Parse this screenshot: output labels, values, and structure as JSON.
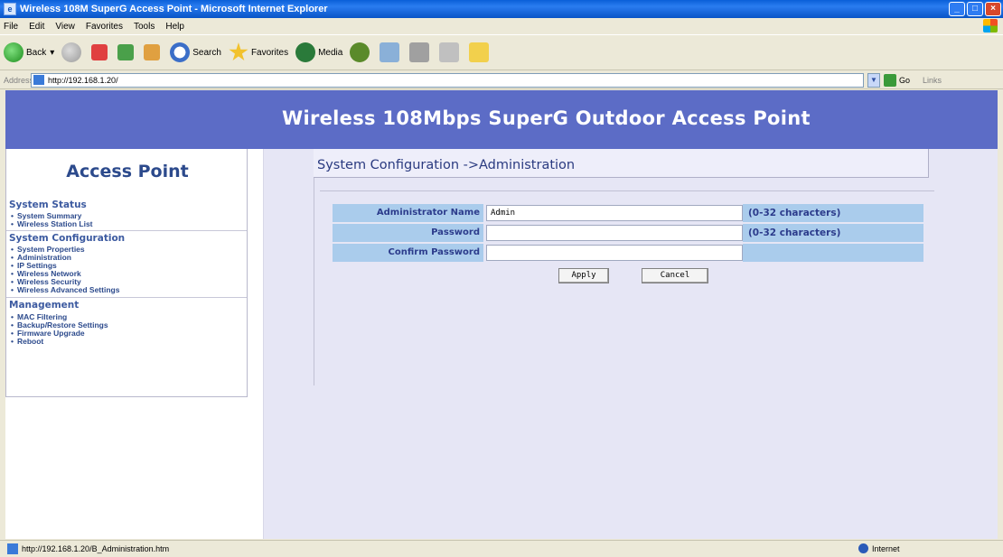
{
  "window": {
    "title": "Wireless 108M SuperG Access Point - Microsoft Internet Explorer"
  },
  "menu": [
    "File",
    "Edit",
    "View",
    "Favorites",
    "Tools",
    "Help"
  ],
  "toolbar": {
    "back_label": "Back",
    "search_label": "Search",
    "favorites_label": "Favorites",
    "media_label": "Media"
  },
  "address": {
    "label": "Address",
    "url": "http://192.168.1.20/",
    "go_label": "Go",
    "links_label": "Links"
  },
  "banner": {
    "title": "Wireless 108Mbps SuperG Outdoor Access Point"
  },
  "sidebar": {
    "title": "Access Point",
    "sections": [
      {
        "heading": "System Status",
        "items": [
          "System Summary",
          "Wireless Station List"
        ]
      },
      {
        "heading": "System Configuration",
        "items": [
          "System Properties",
          "Administration",
          "IP Settings",
          "Wireless Network",
          "Wireless Security",
          "Wireless Advanced Settings"
        ]
      },
      {
        "heading": "Management",
        "items": [
          "MAC Filtering",
          "Backup/Restore Settings",
          "Firmware Upgrade",
          "Reboot"
        ]
      }
    ]
  },
  "main": {
    "header": "System Configuration ->Administration",
    "fields": [
      {
        "label": "Administrator Name",
        "value": "Admin",
        "hint": "(0-32 characters)"
      },
      {
        "label": "Password",
        "value": "",
        "hint": "(0-32 characters)"
      },
      {
        "label": "Confirm Password",
        "value": "",
        "hint": ""
      }
    ],
    "apply_label": "Apply",
    "cancel_label": "Cancel"
  },
  "status": {
    "url": "http://192.168.1.20/B_Administration.htm",
    "zone": "Internet"
  },
  "colors": {
    "banner": "#5c6cc6",
    "label_bg": "#aaccec",
    "content_bg": "#e6e6f5",
    "heading": "#2c4a8c"
  }
}
